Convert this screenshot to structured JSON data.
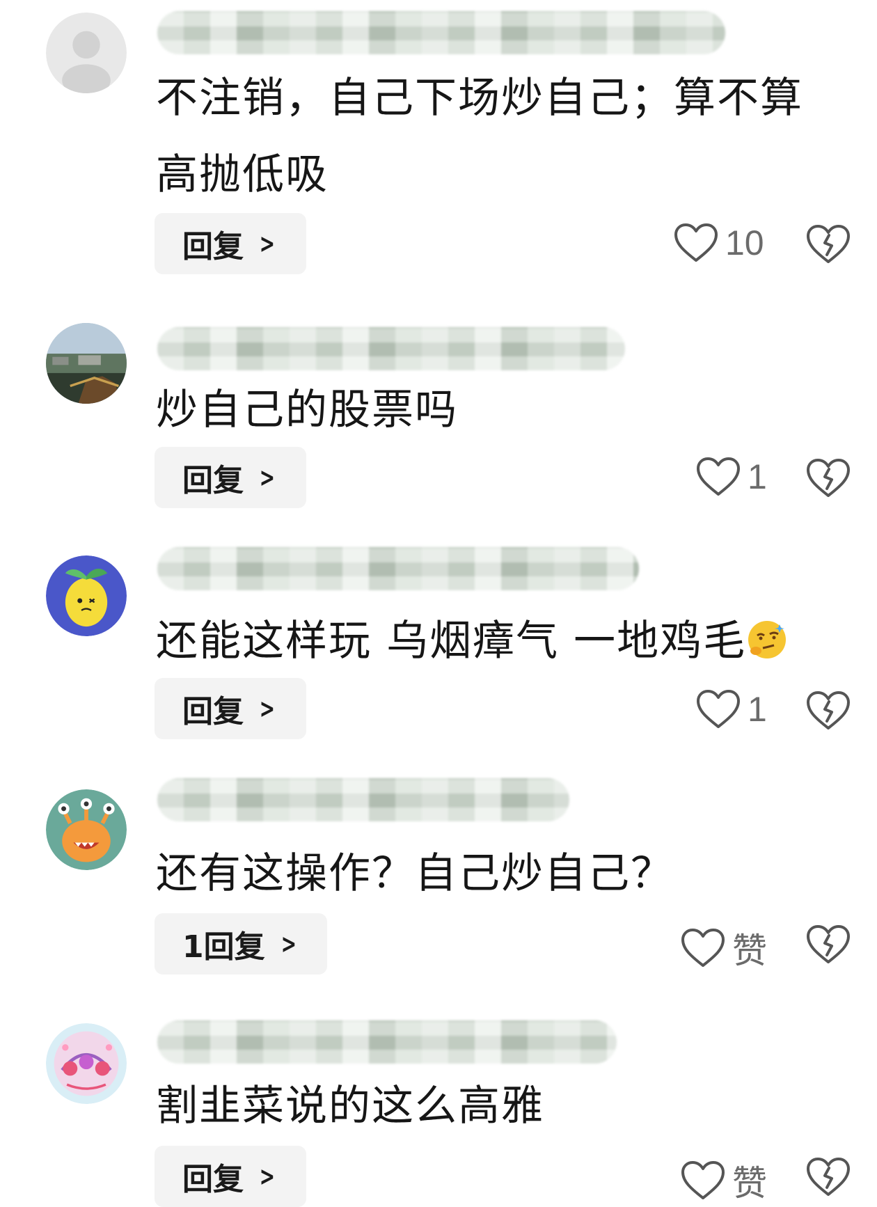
{
  "comments": [
    {
      "text": "不注销，自己下场炒自己；算不算高抛低吸",
      "reply_label": "回复",
      "like_count": "10"
    },
    {
      "text": "炒自己的股票吗",
      "reply_label": "回复",
      "like_count": "1"
    },
    {
      "text": "还能这样玩 乌烟瘴气 一地鸡毛",
      "emoji": "smirk-thinking-emoji",
      "reply_label": "回复",
      "like_count": "1"
    },
    {
      "text": "还有这操作？自己炒自己？",
      "reply_label": "1回复",
      "like_count": "赞"
    },
    {
      "text": "割韭菜说的这么高雅",
      "reply_label": "回复",
      "like_count": "赞"
    }
  ],
  "icons": {
    "like": "heart-outline-icon",
    "dislike": "broken-heart-icon",
    "reply_chevron": "chevron-right-icon"
  },
  "colors": {
    "text": "#161616",
    "muted": "#6b6b6b",
    "reply_bg": "#f3f3f3"
  }
}
